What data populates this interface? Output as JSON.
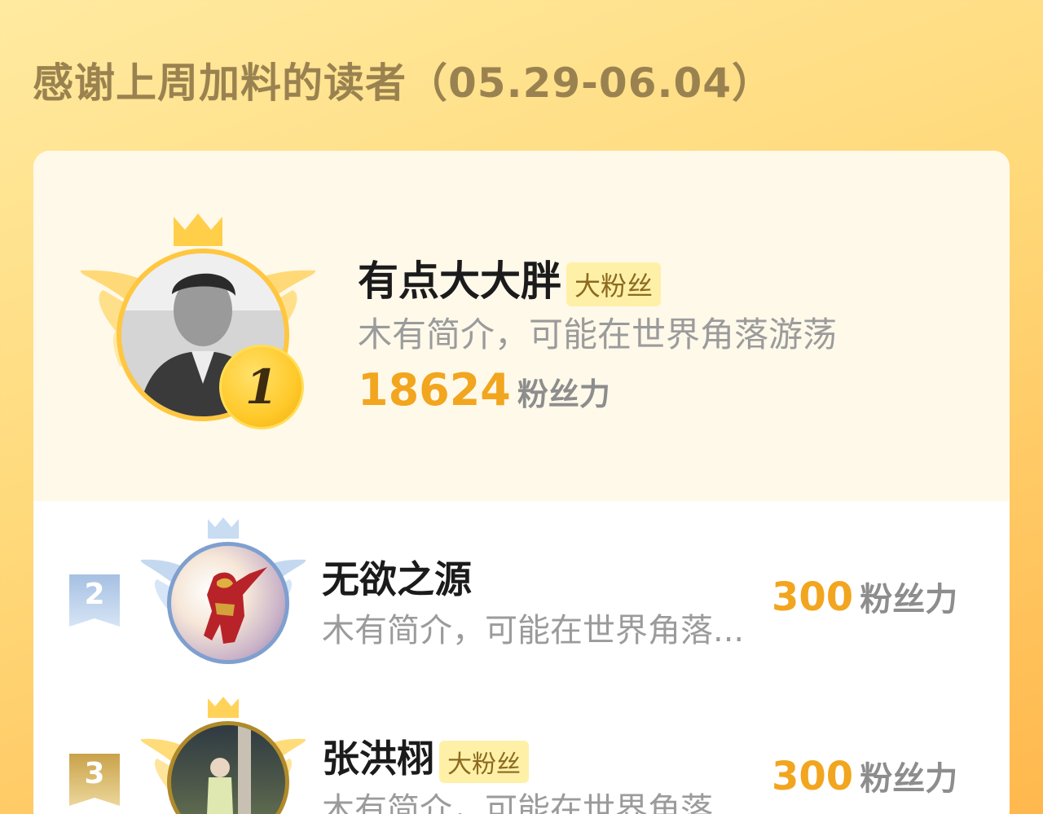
{
  "page": {
    "title": "感谢上周加料的读者（05.29-06.04）"
  },
  "first": {
    "rank": "1",
    "name": "有点大大胖",
    "tag": "大粉丝",
    "bio": "木有简介，可能在世界角落游荡",
    "score": "18624",
    "score_unit": "粉丝力"
  },
  "rows": [
    {
      "rank": "2",
      "name": "无欲之源",
      "tag": "",
      "bio": "木有简介，可能在世界角落...",
      "score": "300",
      "score_unit": "粉丝力"
    },
    {
      "rank": "3",
      "name": "张洪栩",
      "tag": "大粉丝",
      "bio": "木有简介，可能在世界角落...",
      "score": "300",
      "score_unit": "粉丝力"
    }
  ],
  "colors": {
    "gold": "#ffc740",
    "silver": "#7f9fcf",
    "bronze": "#c9a24a",
    "score": "#f2a51e"
  }
}
